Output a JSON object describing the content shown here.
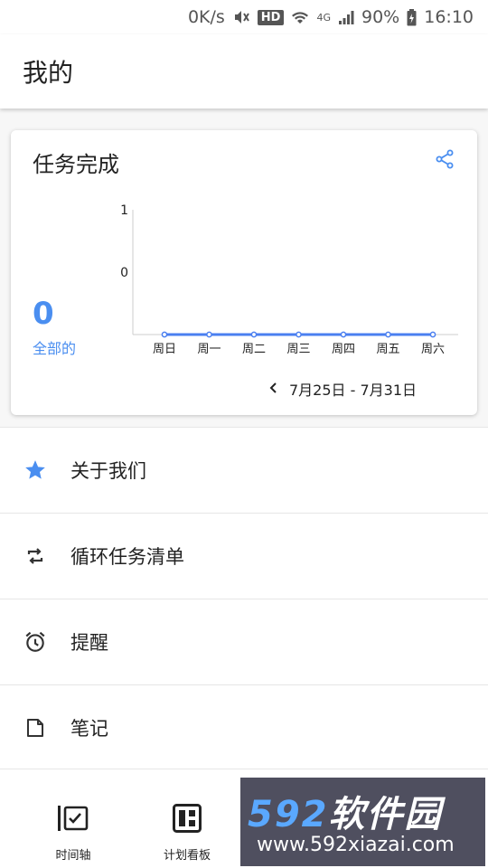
{
  "status_bar": {
    "speed": "0K/s",
    "hd": "HD",
    "network": "4G",
    "battery": "90%",
    "time": "16:10"
  },
  "app_bar": {
    "title": "我的"
  },
  "task_card": {
    "title": "任务完成",
    "total_count": "0",
    "total_label": "全部的",
    "date_range": "7月25日 - 7月31日"
  },
  "chart_data": {
    "type": "line",
    "categories": [
      "周日",
      "周一",
      "周二",
      "周三",
      "周四",
      "周五",
      "周六"
    ],
    "series": [
      {
        "values": [
          0,
          0,
          0,
          0,
          0,
          0,
          0
        ]
      }
    ],
    "y_ticks": [
      "1",
      "0"
    ],
    "grid": false,
    "color": "#4a7ff0"
  },
  "menu": [
    {
      "label": "关于我们",
      "icon": "star-icon"
    },
    {
      "label": "循环任务清单",
      "icon": "repeat-icon"
    },
    {
      "label": "提醒",
      "icon": "alarm-icon"
    },
    {
      "label": "笔记",
      "icon": "note-icon"
    }
  ],
  "bottom_nav": [
    {
      "label": "时间轴",
      "icon": "timeline-icon"
    },
    {
      "label": "计划看板",
      "icon": "board-icon"
    }
  ],
  "watermark": {
    "brand_num": "592",
    "brand_text": "软件园",
    "url": "www.592xiazai.com"
  },
  "colors": {
    "accent": "#4a8ef0"
  }
}
